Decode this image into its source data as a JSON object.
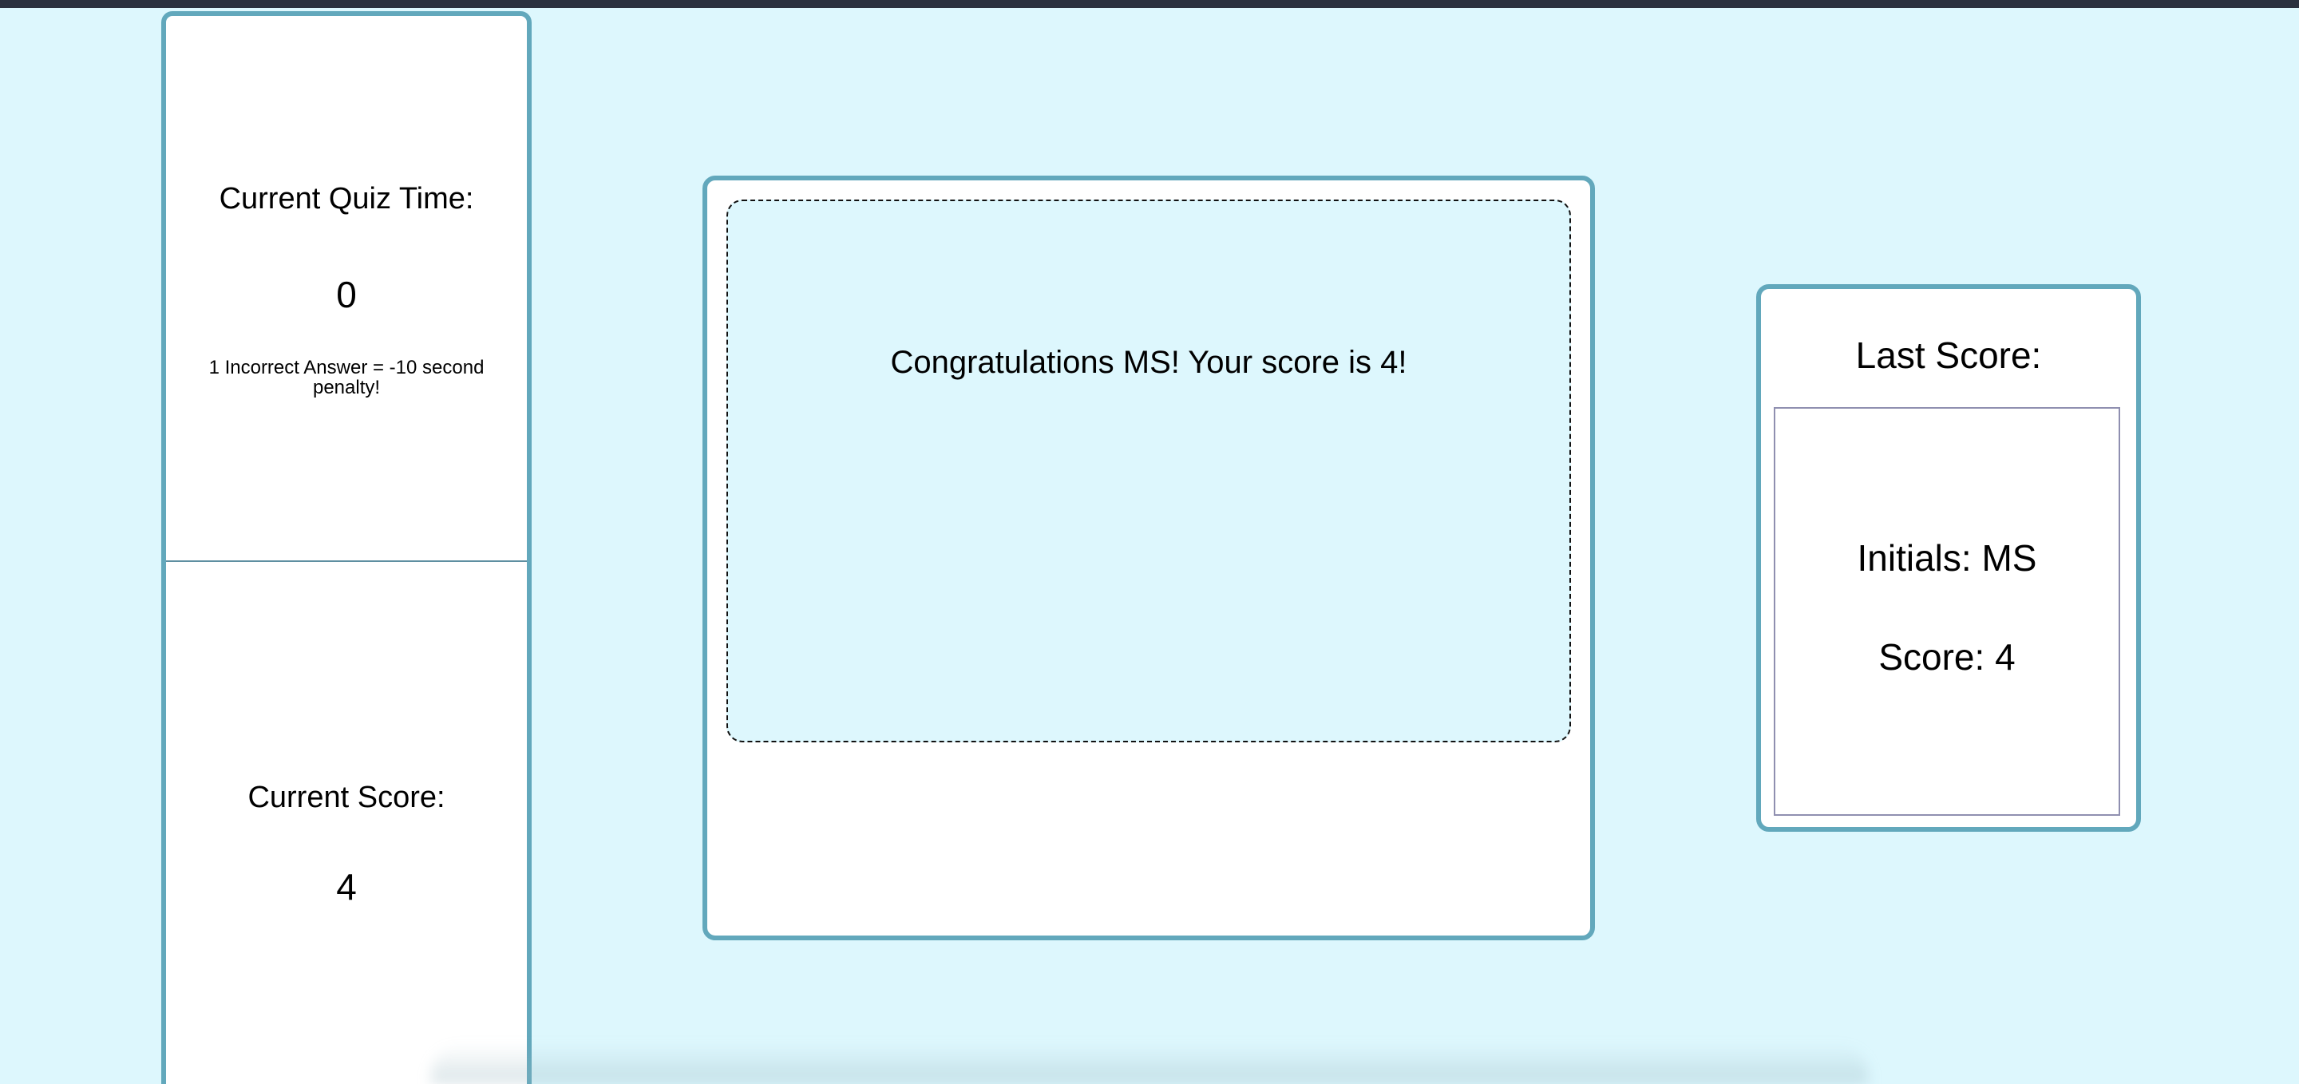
{
  "timer": {
    "label": "Current Quiz Time:",
    "value": "0",
    "penalty_note": "1 Incorrect Answer = -10 second penalty!"
  },
  "current_score": {
    "label": "Current Score:",
    "value": "4"
  },
  "quiz": {
    "message": "Congratulations MS! Your score is 4!"
  },
  "last_score": {
    "title": "Last Score:",
    "initials": "Initials: MS",
    "score": "Score: 4"
  },
  "colors": {
    "background": "#ddf7fd",
    "panel_border": "#62a8bc",
    "top_bar": "#2b313f"
  }
}
